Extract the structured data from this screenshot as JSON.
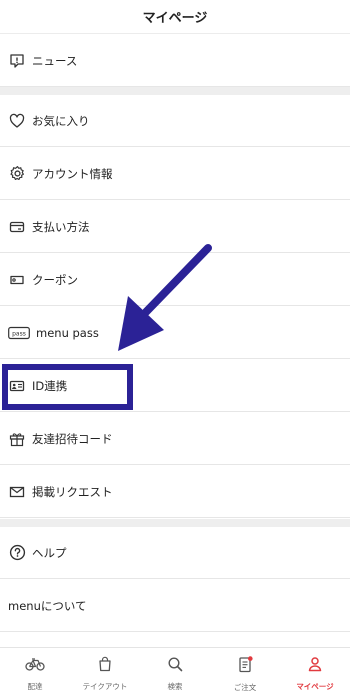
{
  "header": {
    "title": "マイページ"
  },
  "menu": {
    "news": "ニュース",
    "favorites": "お気に入り",
    "account": "アカウント情報",
    "payment": "支払い方法",
    "coupon": "クーポン",
    "pass": "menu pass",
    "pass_badge": "pass",
    "id_link": "ID連携",
    "invite": "友達招待コード",
    "request": "掲載リクエスト",
    "help": "ヘルプ",
    "about": "menuについて"
  },
  "tabs": {
    "delivery": "配達",
    "takeout": "テイクアウト",
    "search": "検索",
    "orders": "ご注文",
    "mypage": "マイページ"
  },
  "colors": {
    "accent": "#e13a3f",
    "annotation": "#2b2296",
    "separator": "#eeeeee"
  }
}
